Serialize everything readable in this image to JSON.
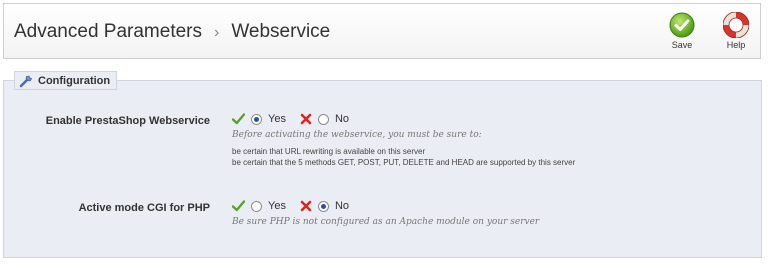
{
  "header": {
    "breadcrumb": [
      "Advanced Parameters",
      "Webservice"
    ],
    "separator": "›",
    "toolbar": {
      "save_label": "Save",
      "help_label": "Help",
      "save_icon": "check-circle-icon",
      "help_icon": "lifebuoy-icon"
    }
  },
  "fieldset": {
    "legend": "Configuration",
    "legend_icon": "wrench-icon",
    "rows": [
      {
        "label": "Enable PrestaShop Webservice",
        "yes_label": "Yes",
        "no_label": "No",
        "selected": "Yes",
        "hint": "Before activating the webservice, you must be sure to:",
        "notes": [
          "be certain that URL rewriting is available on this server",
          "be certain that the 5 methods GET, POST, PUT, DELETE and HEAD are supported by this server"
        ]
      },
      {
        "label": "Active mode CGI for PHP",
        "yes_label": "Yes",
        "no_label": "No",
        "selected": "No",
        "hint": "Be sure PHP is not configured as an Apache module on your server"
      }
    ]
  },
  "colors": {
    "check_green": "#5aa02c",
    "cross_red": "#d9261c",
    "panel_bg": "#ebedf4",
    "radio_dot": "#2c4f9e"
  }
}
